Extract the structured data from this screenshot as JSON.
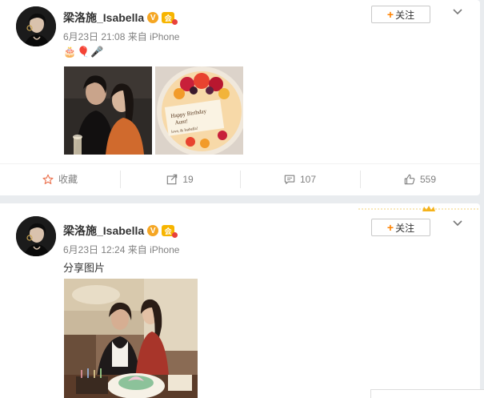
{
  "posts": [
    {
      "username": "梁洛施_Isabella",
      "verified_badge": "V",
      "vip_badge": "会",
      "date": "6月23日 21:08",
      "source": "来自 iPhone",
      "text": "🎂🎈🎤",
      "follow_label": "关注",
      "actions": {
        "favorite": "收藏",
        "repost": "19",
        "comment": "107",
        "like": "559"
      }
    },
    {
      "username": "梁洛施_Isabella",
      "verified_badge": "V",
      "vip_badge": "会",
      "date": "6月23日 12:24",
      "source": "来自 iPhone",
      "text": "分享图片",
      "follow_label": "关注"
    }
  ],
  "colors": {
    "accent_orange": "#ff8200",
    "favorite_red": "#eb7350",
    "meta_gray": "#808080"
  },
  "icons": [
    "star-icon",
    "repost-icon",
    "comment-icon",
    "like-icon",
    "chevron-down-icon",
    "plus-icon",
    "crown-icon"
  ]
}
